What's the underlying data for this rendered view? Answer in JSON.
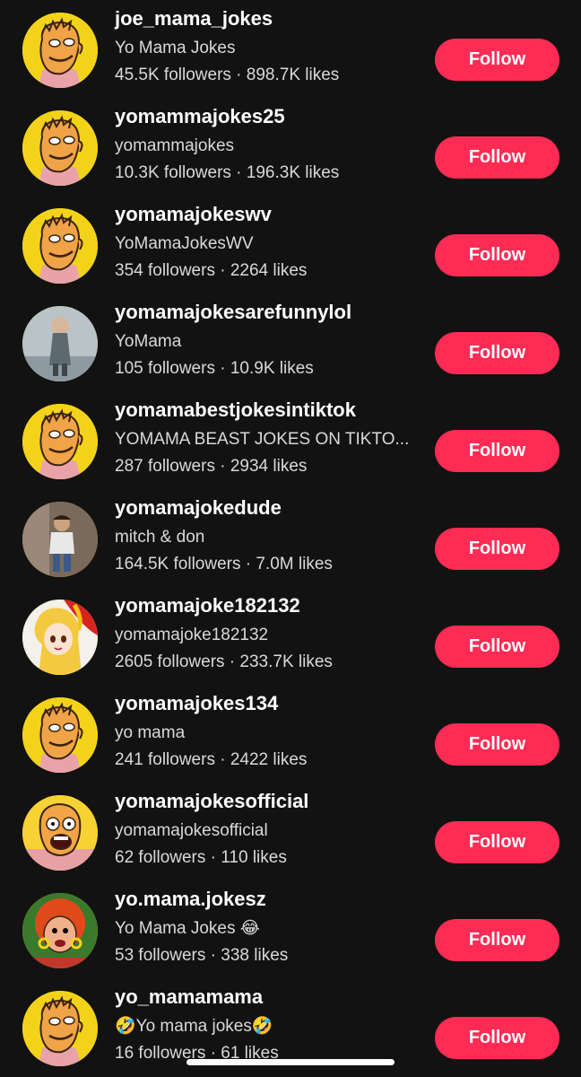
{
  "accounts": [
    {
      "username": "joe_mama_jokes",
      "nickname": "Yo Mama Jokes",
      "stats": "45.5K followers · 898.7K likes",
      "follow_label": "Follow",
      "avatar": "cartoon-man-icon"
    },
    {
      "username": "yomammajokes25",
      "nickname": "yomammajokes",
      "stats": "10.3K followers · 196.3K likes",
      "follow_label": "Follow",
      "avatar": "cartoon-man-icon"
    },
    {
      "username": "yomamajokeswv",
      "nickname": "YoMamaJokesWV",
      "stats": "354 followers · 2264 likes",
      "follow_label": "Follow",
      "avatar": "cartoon-man-icon"
    },
    {
      "username": "yomamajokesarefunnylol",
      "nickname": "YoMama",
      "stats": "105 followers · 10.9K likes",
      "follow_label": "Follow",
      "avatar": "photo-figure-icon"
    },
    {
      "username": "yomamabestjokesintiktok",
      "nickname": "YOMAMA BEAST JOKES ON TIKTO...",
      "stats": "287 followers · 2934 likes",
      "follow_label": "Follow",
      "avatar": "cartoon-man-icon"
    },
    {
      "username": "yomamajokedude",
      "nickname": "mitch & don",
      "stats": "164.5K followers · 7.0M likes",
      "follow_label": "Follow",
      "avatar": "photo-person-icon"
    },
    {
      "username": "yomamajoke182132",
      "nickname": "yomamajoke182132",
      "stats": "2605 followers · 233.7K likes",
      "follow_label": "Follow",
      "avatar": "anime-girl-icon"
    },
    {
      "username": "yomamajokes134",
      "nickname": "yo mama",
      "stats": "241 followers · 2422 likes",
      "follow_label": "Follow",
      "avatar": "cartoon-man-icon"
    },
    {
      "username": "yomamajokesofficial",
      "nickname": "yomamajokesofficial",
      "stats": "62 followers · 110 likes",
      "follow_label": "Follow",
      "avatar": "cartoon-shocked-icon"
    },
    {
      "username": "yo.mama.jokesz",
      "nickname": "Yo Mama Jokes 😂",
      "stats": "53 followers · 338 likes",
      "follow_label": "Follow",
      "avatar": "cartoon-lady-icon"
    },
    {
      "username": "yo_mamamama",
      "nickname": "🤣Yo mama jokes🤣",
      "stats": "16 followers · 61 likes",
      "follow_label": "Follow",
      "avatar": "cartoon-man-icon"
    }
  ],
  "colors": {
    "background": "#121212",
    "follow_button": "#fe2c55",
    "primary_text": "#ffffff",
    "secondary_text": "#d9d9d9"
  }
}
